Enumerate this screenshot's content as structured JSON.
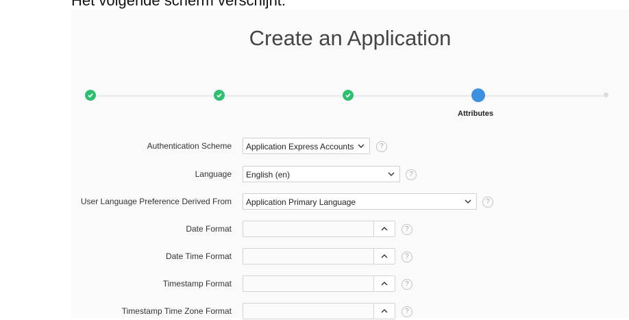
{
  "page": {
    "note": "Het volgende scherm verschijnt:",
    "title": "Create an Application"
  },
  "wizard": {
    "steps": [
      {
        "state": "complete",
        "label": ""
      },
      {
        "state": "complete",
        "label": ""
      },
      {
        "state": "complete",
        "label": ""
      },
      {
        "state": "current",
        "label": "Attributes"
      },
      {
        "state": "pending",
        "label": ""
      }
    ]
  },
  "form": {
    "authentication_scheme": {
      "label": "Authentication Scheme",
      "value": "Application Express Accounts"
    },
    "language": {
      "label": "Language",
      "value": "English (en)"
    },
    "user_language_pref": {
      "label": "User Language Preference Derived From",
      "value": "Application Primary Language"
    },
    "date_format": {
      "label": "Date Format",
      "value": ""
    },
    "date_time_format": {
      "label": "Date Time Format",
      "value": ""
    },
    "timestamp_format": {
      "label": "Timestamp Format",
      "value": ""
    },
    "timestamp_tz_format": {
      "label": "Timestamp Time Zone Format",
      "value": ""
    },
    "help_glyph": "?"
  },
  "colors": {
    "step_complete": "#2fbf71",
    "step_current": "#3d8fe0",
    "step_pending": "#dcdcdc"
  }
}
